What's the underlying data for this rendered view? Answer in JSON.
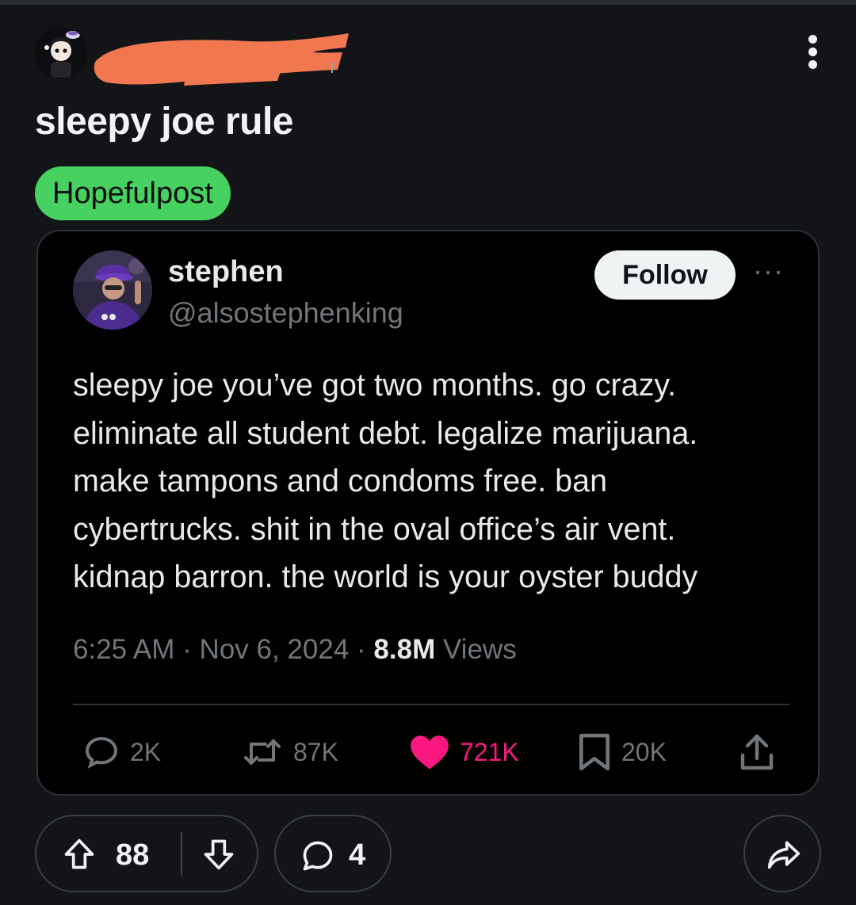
{
  "post": {
    "title": "sleepy joe rule",
    "flair": "Hopefulpost",
    "flair_color": "#46d160"
  },
  "tweet": {
    "name": "stephen",
    "handle": "@alsostephenking",
    "follow_label": "Follow",
    "more_label": "···",
    "text_lines": [
      "sleepy joe you’ve got two months. go crazy.",
      "eliminate all student debt. legalize marijuana.",
      "make tampons and condoms free. ban",
      "cybertrucks. shit in the oval office’s air vent.",
      "kidnap barron. the world is your oyster buddy"
    ],
    "time": "6:25 AM",
    "date": "Nov 6, 2024",
    "views_count": "8.8M",
    "views_label": "Views",
    "replies": "2K",
    "reposts": "87K",
    "likes": "721K",
    "bookmarks": "20K",
    "like_color": "#f91880"
  },
  "actions": {
    "score": "88",
    "comments": "4"
  },
  "icons": {
    "post_menu": "kebab-menu-icon",
    "reply": "reply-bubble-icon",
    "repost": "repost-icon",
    "like": "heart-icon",
    "bookmark": "bookmark-icon",
    "share_tweet": "share-upload-icon",
    "upvote": "upvote-arrow-icon",
    "downvote": "downvote-arrow-icon",
    "comment": "comment-bubble-icon",
    "share_post": "share-arrow-icon"
  }
}
